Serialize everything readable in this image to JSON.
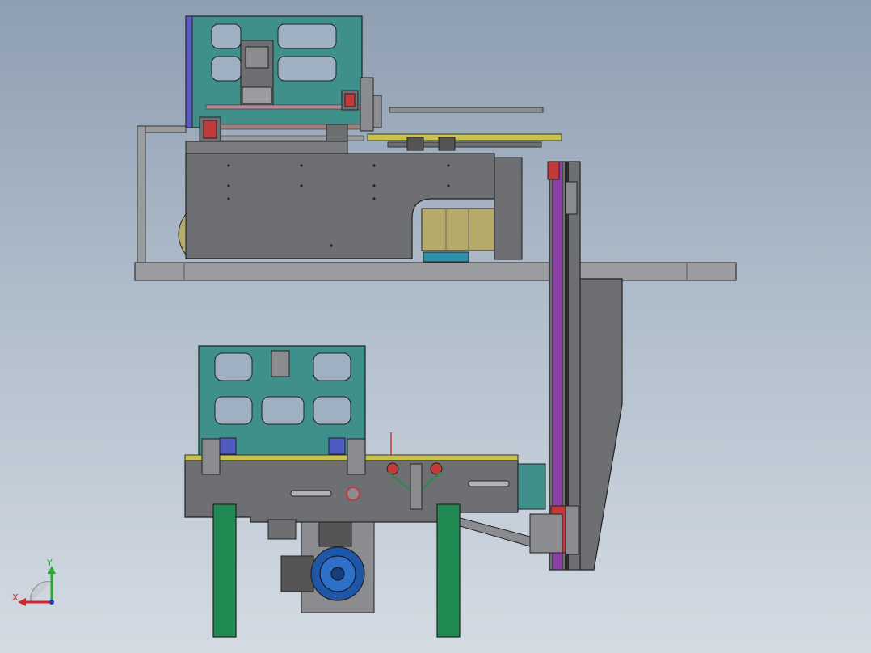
{
  "viewport": {
    "background_top": "#8e9fb2",
    "background_bottom": "#d4dbe3"
  },
  "triad": {
    "x_label": "X",
    "y_label": "Y",
    "x_color": "#d8232a",
    "y_color": "#1fae2c",
    "z_color": "#1f3fbf"
  },
  "colors": {
    "frame_gray": "#6d6f73",
    "teal_panel": "#3f8f8a",
    "green_leg": "#1f8a52",
    "motor_blue": "#1f57a8",
    "purple_rail": "#8d3fa8",
    "olive_cylinder": "#b5aa6a",
    "red_part": "#c23a3a",
    "yellow_edge": "#c9c34a"
  },
  "icons": {
    "triad": "coordinate-triad-icon"
  }
}
